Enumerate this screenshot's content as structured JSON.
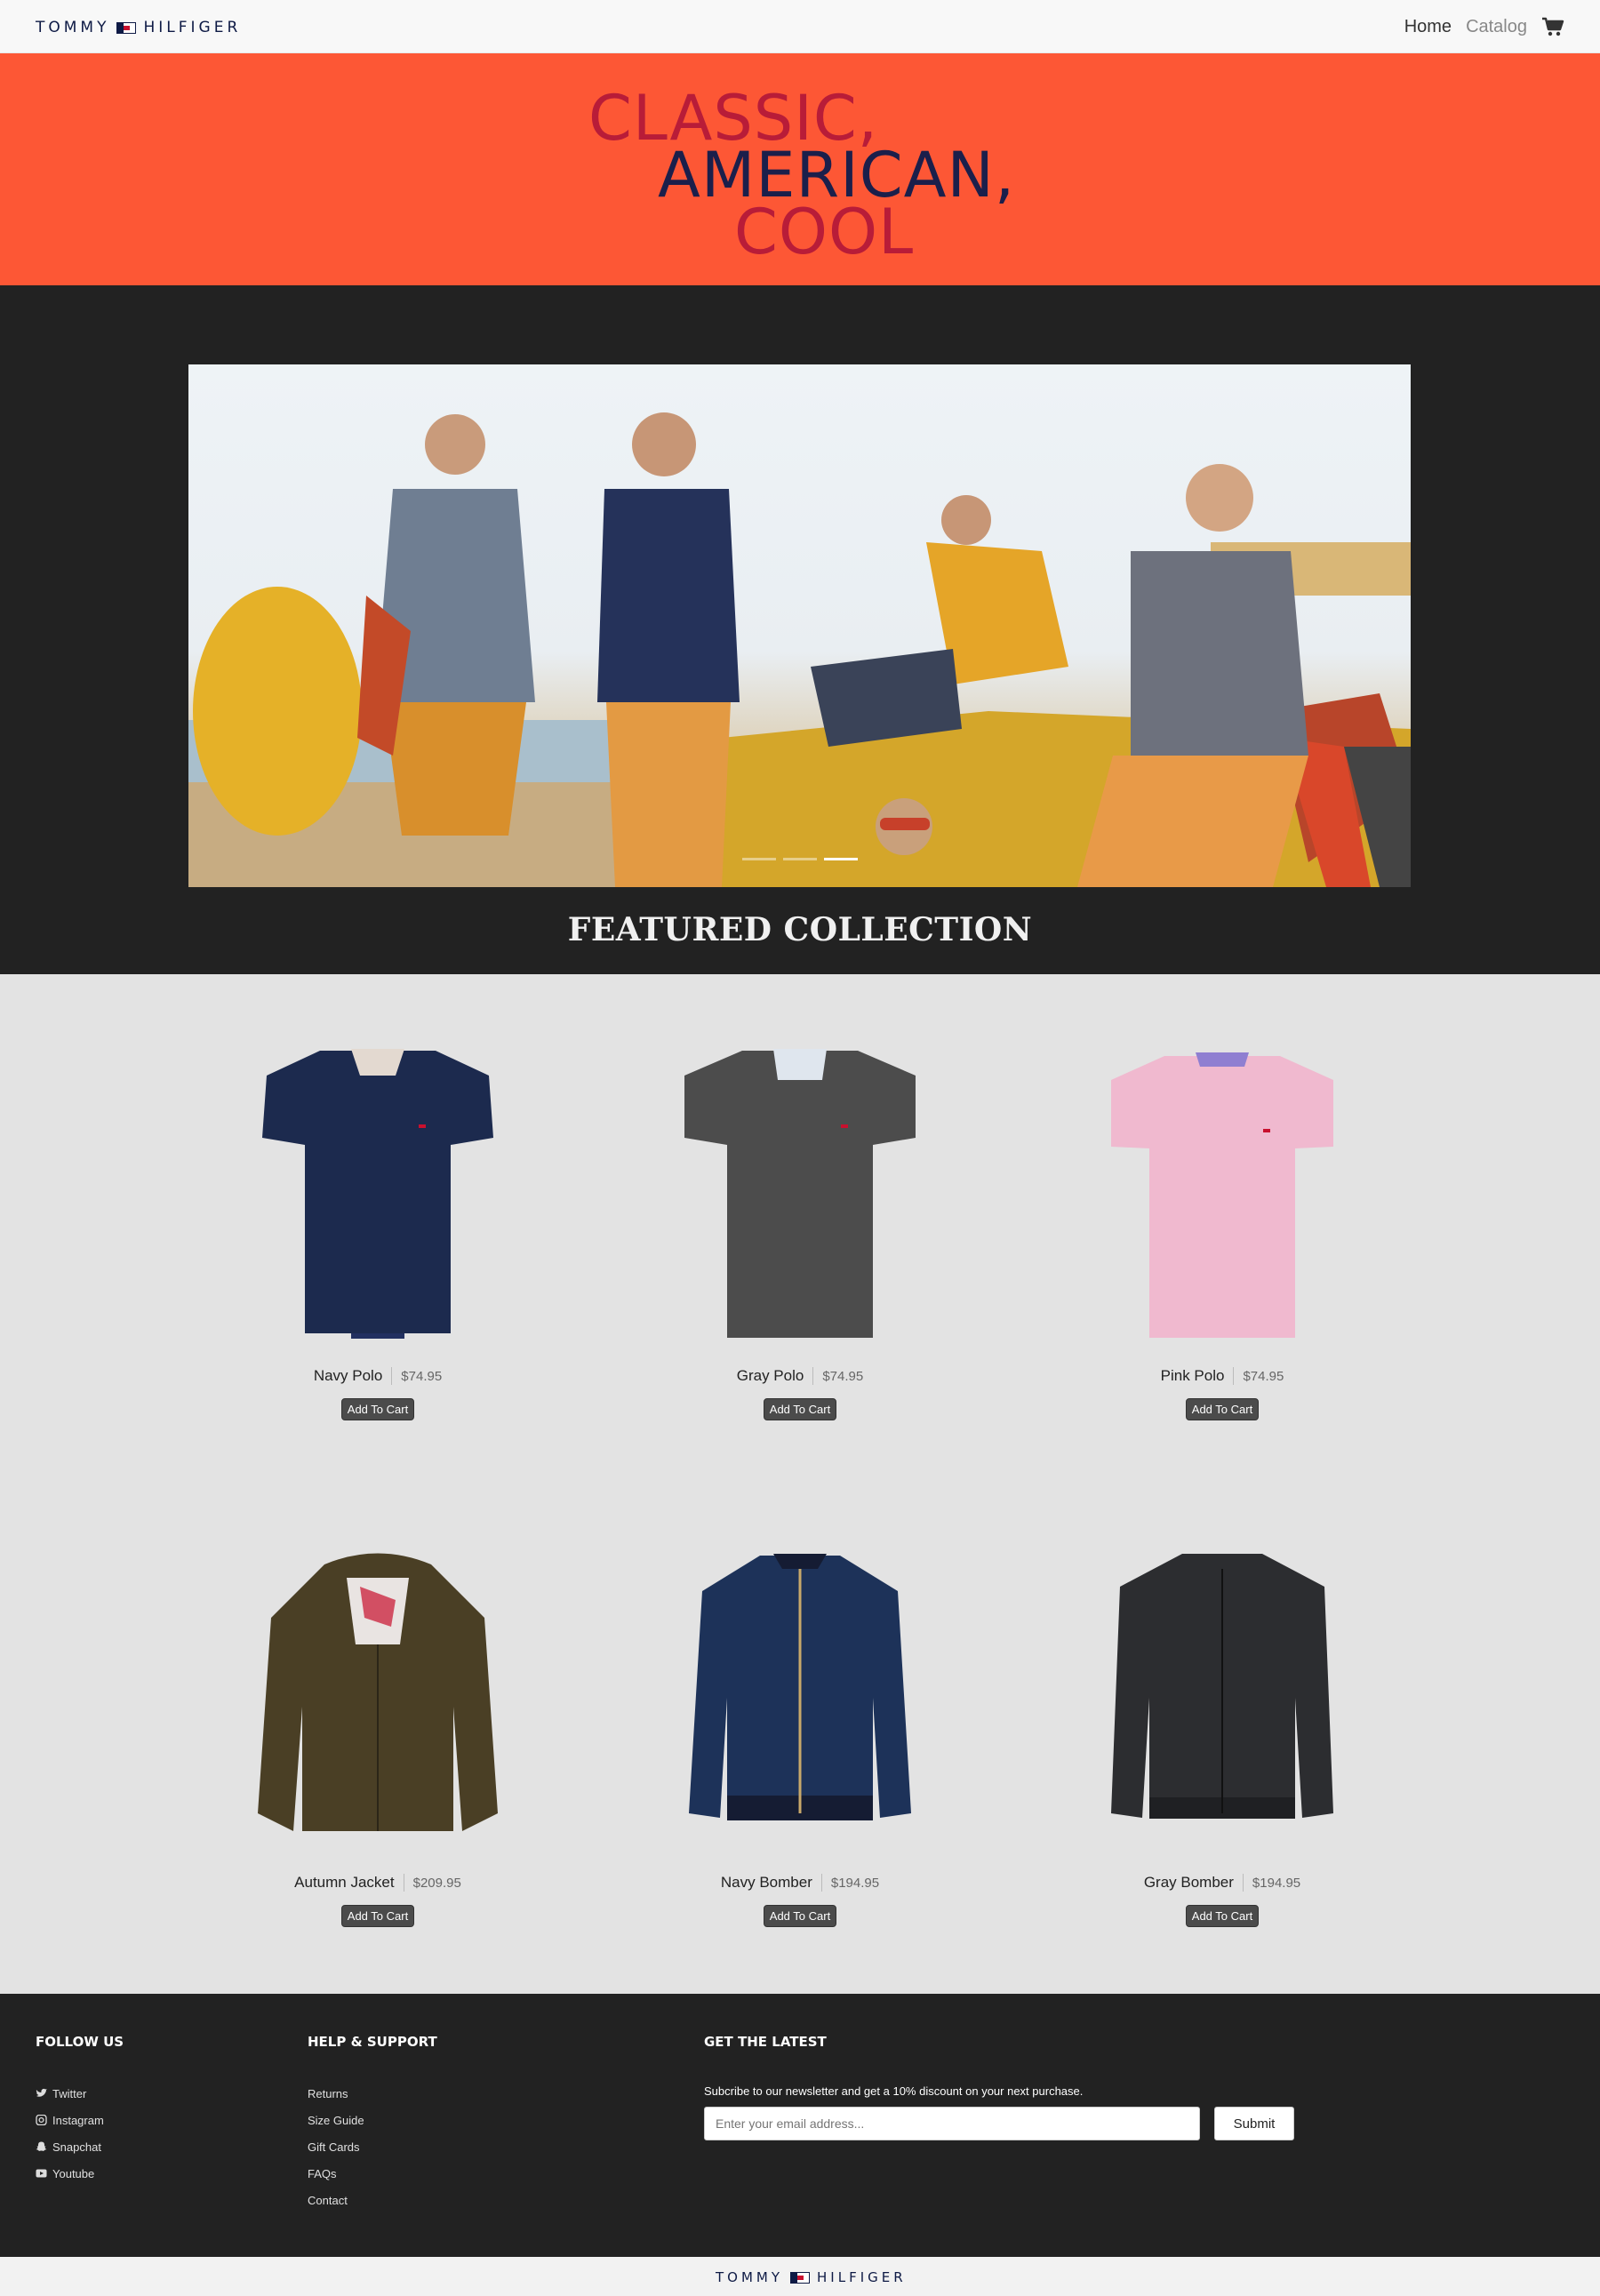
{
  "navbar": {
    "brand_left": "TOMMY",
    "brand_right": "HILFIGER",
    "links": [
      {
        "label": "Home"
      },
      {
        "label": "Catalog"
      }
    ],
    "cart_icon": "shopping-cart-icon"
  },
  "hero": {
    "line1": "CLASSIC,",
    "line2": "AMERICAN,",
    "line3": "COOL",
    "colors": {
      "background": "#fd5735",
      "red": "#b81c38",
      "navy": "#1b1f4b"
    }
  },
  "carousel": {
    "slide_count": 3,
    "active_slide": 3
  },
  "featured": {
    "title": "FEATURED COLLECTION"
  },
  "products": [
    {
      "name": "Navy Polo",
      "price": "$74.95",
      "button": "Add To Cart",
      "type": "polo",
      "color": "#1c2a4e"
    },
    {
      "name": "Gray Polo",
      "price": "$74.95",
      "button": "Add To Cart",
      "type": "polo",
      "color": "#4c4c4c"
    },
    {
      "name": "Pink Polo",
      "price": "$74.95",
      "button": "Add To Cart",
      "type": "polo",
      "color": "#f0b9cf"
    },
    {
      "name": "Autumn Jacket",
      "price": "$209.95",
      "button": "Add To Cart",
      "type": "jacket",
      "color": "#4a3f25"
    },
    {
      "name": "Navy Bomber",
      "price": "$194.95",
      "button": "Add To Cart",
      "type": "bomber",
      "color": "#1d3259"
    },
    {
      "name": "Gray Bomber",
      "price": "$194.95",
      "button": "Add To Cart",
      "type": "bomber",
      "color": "#2c2d30"
    }
  ],
  "footer": {
    "follow": {
      "heading": "FOLLOW US",
      "items": [
        {
          "label": "Twitter",
          "icon": "twitter-icon"
        },
        {
          "label": "Instagram",
          "icon": "instagram-icon"
        },
        {
          "label": "Snapchat",
          "icon": "snapchat-icon"
        },
        {
          "label": "Youtube",
          "icon": "youtube-icon"
        }
      ]
    },
    "help": {
      "heading": "HELP & SUPPORT",
      "items": [
        {
          "label": "Returns"
        },
        {
          "label": "Size Guide"
        },
        {
          "label": "Gift Cards"
        },
        {
          "label": "FAQs"
        },
        {
          "label": "Contact"
        }
      ]
    },
    "latest": {
      "heading": "GET THE LATEST",
      "text": "Subcribe to our newsletter and get a 10% discount on your next purchase.",
      "placeholder": "Enter your email address...",
      "submit": "Submit"
    }
  },
  "bottom": {
    "brand_left": "TOMMY",
    "brand_right": "HILFIGER"
  }
}
